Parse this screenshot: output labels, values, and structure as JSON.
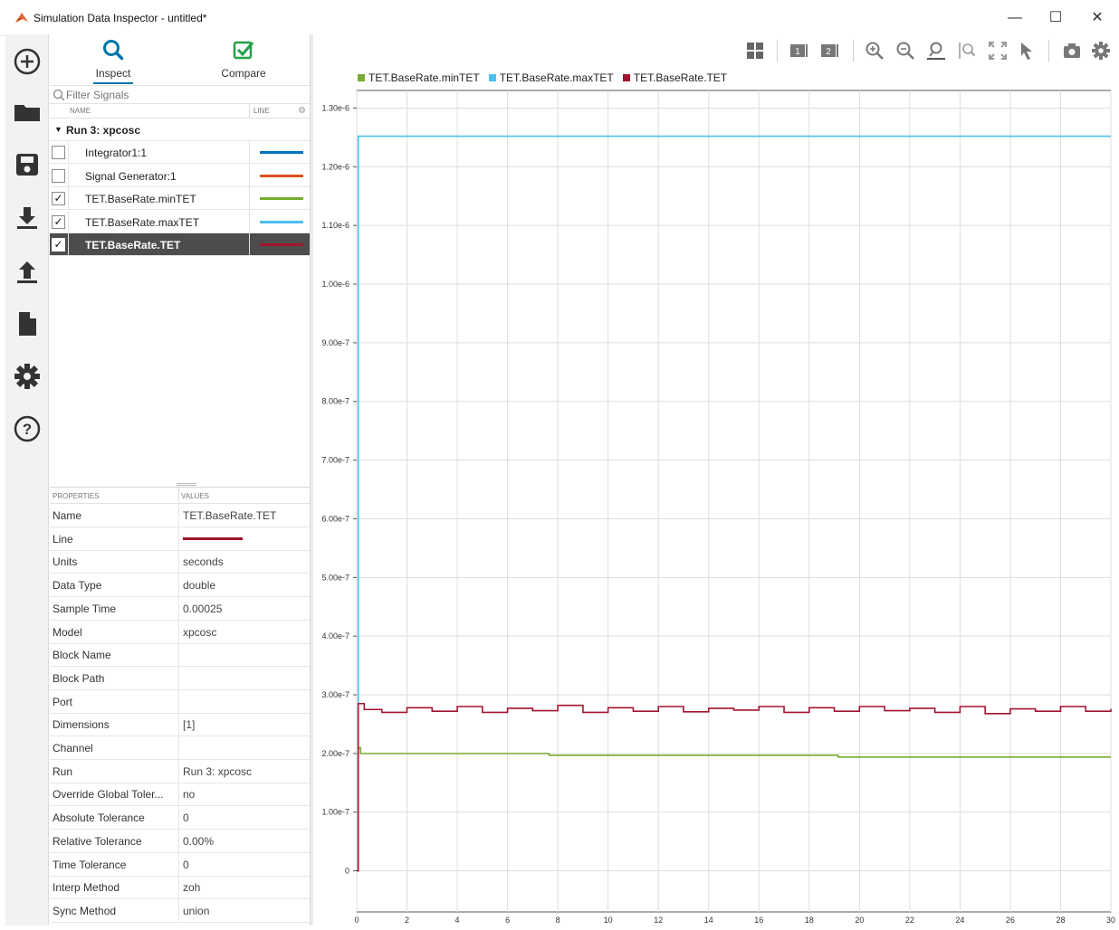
{
  "window": {
    "title": "Simulation Data Inspector - untitled*",
    "minimize": "—",
    "maximize": "☐",
    "close": "✕"
  },
  "rail": {
    "items": [
      {
        "icon": "plus-circle-icon"
      },
      {
        "icon": "folder-icon"
      },
      {
        "icon": "save-icon"
      },
      {
        "icon": "download-icon"
      },
      {
        "icon": "upload-icon"
      },
      {
        "icon": "document-icon"
      },
      {
        "icon": "gear-icon"
      },
      {
        "icon": "help-icon"
      }
    ]
  },
  "modes": {
    "inspect": "Inspect",
    "compare": "Compare",
    "active": "inspect"
  },
  "filter": {
    "placeholder": "Filter Signals"
  },
  "signal_columns": {
    "name": "NAME",
    "line": "LINE"
  },
  "run": {
    "label": "Run 3: xpcosc"
  },
  "signals": [
    {
      "name": "Integrator1:1",
      "checked": false,
      "color": "#0072bd",
      "selected": false
    },
    {
      "name": "Signal Generator:1",
      "checked": false,
      "color": "#d95319",
      "selected": false
    },
    {
      "name": "TET.BaseRate.minTET",
      "checked": true,
      "color": "#77ac30",
      "selected": false
    },
    {
      "name": "TET.BaseRate.maxTET",
      "checked": true,
      "color": "#4dbeee",
      "selected": false
    },
    {
      "name": "TET.BaseRate.TET",
      "checked": true,
      "color": "#a2142f",
      "selected": true
    }
  ],
  "properties": {
    "header_key": "PROPERTIES",
    "header_value": "VALUES",
    "line_color": "#a2142f",
    "rows": [
      {
        "key": "Name",
        "value": "TET.BaseRate.TET"
      },
      {
        "key": "Line",
        "value": ""
      },
      {
        "key": "Units",
        "value": "seconds"
      },
      {
        "key": "Data Type",
        "value": "double"
      },
      {
        "key": "Sample Time",
        "value": "0.00025"
      },
      {
        "key": "Model",
        "value": "xpcosc"
      },
      {
        "key": "Block Name",
        "value": ""
      },
      {
        "key": "Block Path",
        "value": ""
      },
      {
        "key": "Port",
        "value": ""
      },
      {
        "key": "Dimensions",
        "value": "[1]"
      },
      {
        "key": "Channel",
        "value": ""
      },
      {
        "key": "Run",
        "value": "Run 3: xpcosc"
      },
      {
        "key": "Override Global Toler...",
        "value": "no"
      },
      {
        "key": "Absolute Tolerance",
        "value": "0"
      },
      {
        "key": "Relative Tolerance",
        "value": "0.00%"
      },
      {
        "key": "Time Tolerance",
        "value": "0"
      },
      {
        "key": "Interp Method",
        "value": "zoh"
      },
      {
        "key": "Sync Method",
        "value": "union"
      }
    ]
  },
  "toolbar": {
    "icons": [
      "layout-grid-icon",
      "subplot-1-icon",
      "subplot-2-icon",
      "zoom-in-icon",
      "zoom-out-icon",
      "zoom-time-icon",
      "zoom-y-icon",
      "fit-to-view-icon",
      "cursor-icon",
      "snapshot-icon",
      "settings-icon"
    ],
    "subplot_1_label": "1",
    "subplot_2_label": "2"
  },
  "chart_data": {
    "type": "line",
    "title": "",
    "xlabel": "",
    "ylabel": "",
    "xlim": [
      0,
      30
    ],
    "ylim": [
      -7e-08,
      1.33e-06
    ],
    "grid": true,
    "legend_position": "top",
    "x_ticks": [
      "0",
      "2",
      "4",
      "6",
      "8",
      "10",
      "12",
      "14",
      "16",
      "18",
      "20",
      "22",
      "24",
      "26",
      "28",
      "30"
    ],
    "y_ticks": [
      "0",
      "1.00e-7",
      "2.00e-7",
      "3.00e-7",
      "4.00e-7",
      "5.00e-7",
      "6.00e-7",
      "7.00e-7",
      "8.00e-7",
      "9.00e-7",
      "1.00e-6",
      "1.10e-6",
      "1.20e-6",
      "1.30e-6"
    ],
    "y_tick_values": [
      0,
      1e-07,
      2e-07,
      3e-07,
      4e-07,
      5e-07,
      6e-07,
      7e-07,
      8e-07,
      9e-07,
      1e-06,
      1.1e-06,
      1.2e-06,
      1.3e-06
    ],
    "series": [
      {
        "name": "TET.BaseRate.minTET",
        "color": "#77ac30",
        "x": [
          0,
          0.05,
          0.06,
          0.15,
          7.6,
          7.65,
          19.1,
          19.15,
          30
        ],
        "y": [
          0,
          0,
          2.1e-07,
          2e-07,
          2e-07,
          1.97e-07,
          1.97e-07,
          1.94e-07,
          1.94e-07
        ]
      },
      {
        "name": "TET.BaseRate.maxTET",
        "color": "#4dbeee",
        "x": [
          0,
          0.05,
          0.06,
          30
        ],
        "y": [
          0,
          0,
          1.252e-06,
          1.252e-06
        ]
      },
      {
        "name": "TET.BaseRate.TET",
        "color": "#a2142f",
        "x": [
          0,
          0.05,
          0.06,
          0.3,
          1,
          2,
          3,
          4,
          5,
          6,
          7,
          8,
          9,
          10,
          11,
          12,
          13,
          14,
          15,
          16,
          17,
          18,
          19,
          20,
          21,
          22,
          23,
          24,
          25,
          26,
          27,
          28,
          29,
          30
        ],
        "y": [
          0,
          0,
          2.85e-07,
          2.75e-07,
          2.7e-07,
          2.78e-07,
          2.72e-07,
          2.8e-07,
          2.7e-07,
          2.77e-07,
          2.73e-07,
          2.82e-07,
          2.7e-07,
          2.78e-07,
          2.72e-07,
          2.8e-07,
          2.71e-07,
          2.77e-07,
          2.74e-07,
          2.8e-07,
          2.7e-07,
          2.78e-07,
          2.72e-07,
          2.8e-07,
          2.73e-07,
          2.77e-07,
          2.7e-07,
          2.8e-07,
          2.68e-07,
          2.76e-07,
          2.72e-07,
          2.8e-07,
          2.72e-07,
          2.76e-07
        ]
      }
    ]
  }
}
